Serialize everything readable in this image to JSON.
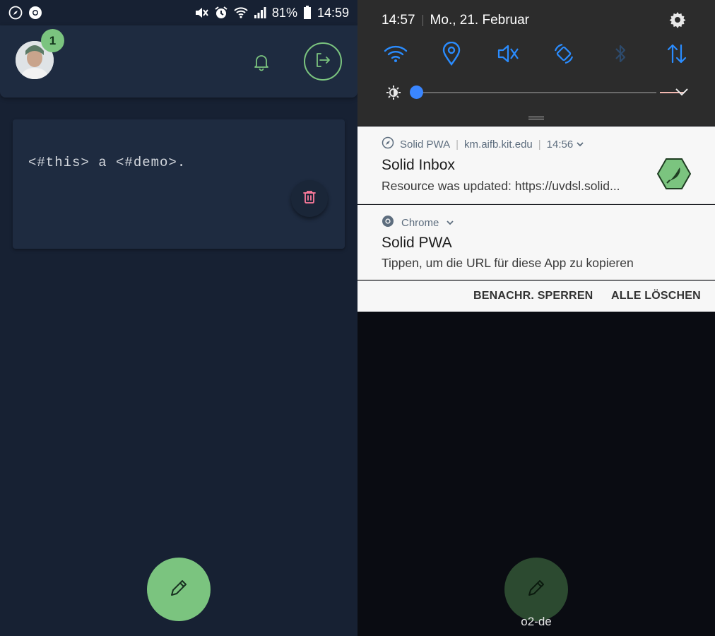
{
  "left_phone": {
    "status_bar": {
      "battery": "81%",
      "time": "14:59",
      "icons": [
        "pwa-compass-icon",
        "chrome-icon",
        "mute-icon",
        "alarm-icon",
        "wifi-icon",
        "signal-icon",
        "battery-icon"
      ]
    },
    "header": {
      "notification_count": "1",
      "icons": [
        "avatar",
        "bell-icon",
        "logout-icon"
      ]
    },
    "card": {
      "text": "<#this> a <#demo>.",
      "icons": [
        "trash-icon"
      ]
    },
    "fab": {
      "icon": "pencil-icon"
    },
    "colors": {
      "background": "#172133",
      "surface": "#1e2b40",
      "accent": "#7bc47f",
      "danger": "#ff7b9c"
    }
  },
  "right_phone": {
    "quick_settings": {
      "time": "14:57",
      "date": "Mo., 21. Februar",
      "toggles": [
        "wifi-icon",
        "location-icon",
        "sound-off-icon",
        "auto-rotate-icon",
        "bluetooth-icon",
        "data-icon"
      ],
      "colors": {
        "active": "#2a8cff",
        "inactive": "#2d4a6b"
      }
    },
    "notifications": [
      {
        "app": "Solid PWA",
        "domain": "km.aifb.kit.edu",
        "time": "14:56",
        "title": "Solid Inbox",
        "body": "Resource was updated: https://uvdsl.solid...",
        "icon": "solid-hex-logo-icon"
      },
      {
        "app": "Chrome",
        "title": "Solid PWA",
        "body": "Tippen, um die URL für diese App zu kopieren",
        "icon": "chrome-icon"
      }
    ],
    "actions": {
      "block": "BENACHR. SPERREN",
      "clear": "ALLE LÖSCHEN"
    },
    "carrier": "o2-de"
  }
}
